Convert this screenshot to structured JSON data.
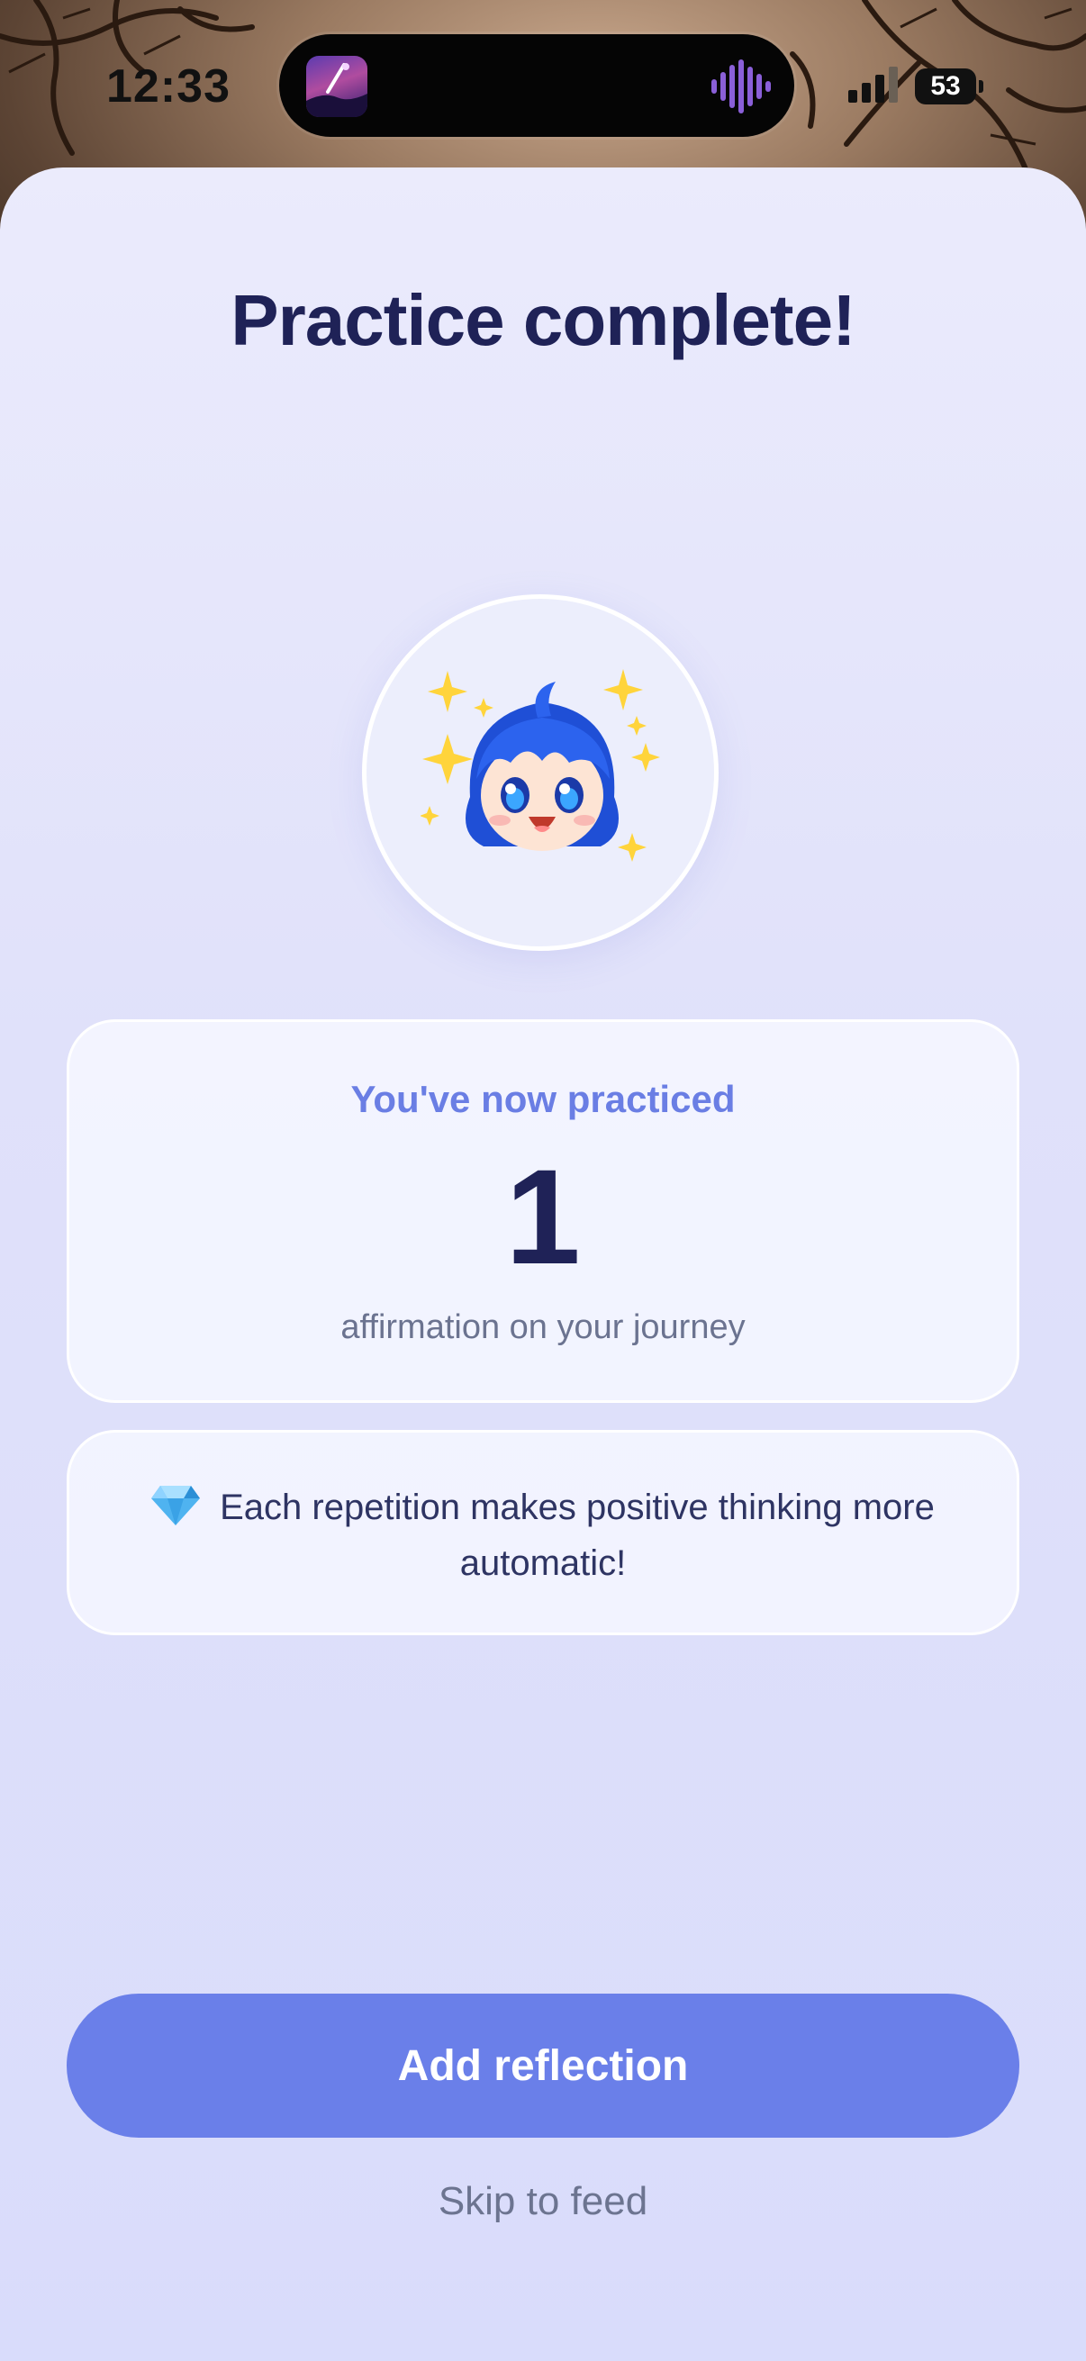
{
  "status_bar": {
    "time": "12:33",
    "battery": "53"
  },
  "screen": {
    "title": "Practice complete!",
    "stats": {
      "label": "You've now practiced",
      "count": "1",
      "subtitle": "affirmation on your journey"
    },
    "tip": {
      "icon": "gem-icon",
      "text": "Each repetition makes positive thinking more automatic!"
    },
    "actions": {
      "primary_label": "Add reflection",
      "skip_label": "Skip to feed"
    }
  },
  "colors": {
    "primary": "#6a7fe9",
    "title": "#1f2257",
    "accent_text": "#6a7ee4"
  }
}
